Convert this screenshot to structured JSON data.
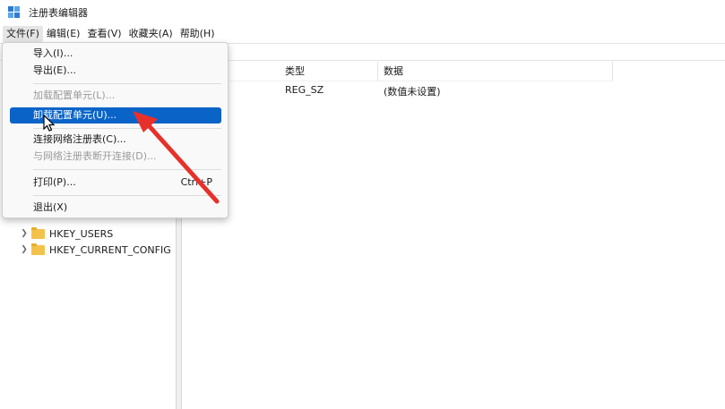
{
  "window": {
    "title": "注册表编辑器"
  },
  "menubar": {
    "items": [
      "文件(F)",
      "编辑(E)",
      "查看(V)",
      "收藏夹(A)",
      "帮助(H)"
    ]
  },
  "file_menu": {
    "items": [
      {
        "label": "导入(I)...",
        "disabled": false,
        "highlighted": false,
        "shortcut": ""
      },
      {
        "label": "导出(E)...",
        "disabled": false,
        "highlighted": false,
        "shortcut": ""
      },
      {
        "label": "加载配置单元(L)...",
        "disabled": true,
        "highlighted": false,
        "shortcut": ""
      },
      {
        "label": "卸载配置单元(U)...",
        "disabled": false,
        "highlighted": true,
        "shortcut": ""
      },
      {
        "label": "连接网络注册表(C)...",
        "disabled": false,
        "highlighted": false,
        "shortcut": ""
      },
      {
        "label": "与网络注册表断开连接(D)...",
        "disabled": true,
        "highlighted": false,
        "shortcut": ""
      },
      {
        "label": "打印(P)...",
        "disabled": false,
        "highlighted": false,
        "shortcut": "Ctrl+P"
      },
      {
        "label": "退出(X)",
        "disabled": false,
        "highlighted": false,
        "shortcut": ""
      }
    ]
  },
  "tree": {
    "items": [
      {
        "label": "HKEY_USERS"
      },
      {
        "label": "HKEY_CURRENT_CONFIG"
      }
    ]
  },
  "list": {
    "columns": [
      "类型",
      "数据"
    ],
    "rows": [
      {
        "type": "REG_SZ",
        "data": "(数值未设置)"
      }
    ]
  },
  "colors": {
    "highlight": "#0a64c8",
    "annotation_arrow": "#e8302a"
  },
  "icons": {
    "app": "registry-editor-icon",
    "folder": "folder-icon",
    "chevron": "chevron-right-icon",
    "cursor": "mouse-pointer-icon"
  }
}
